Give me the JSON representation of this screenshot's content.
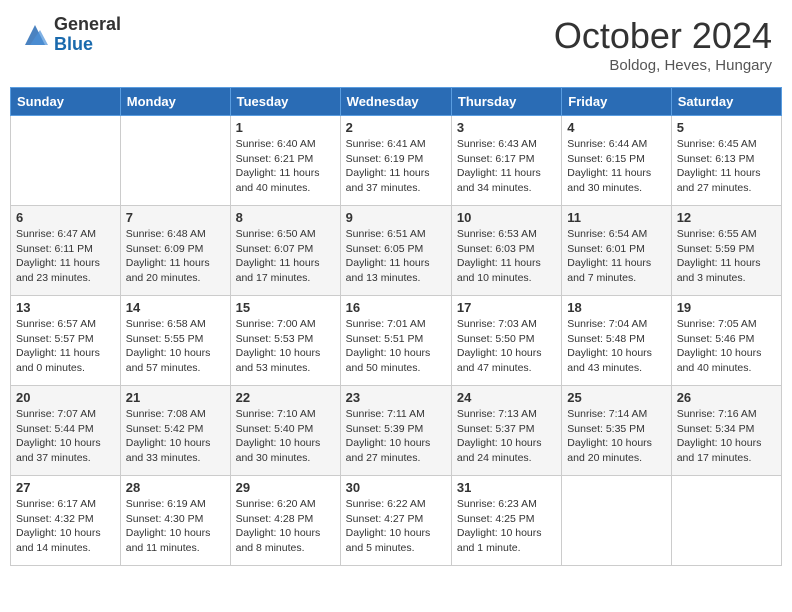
{
  "header": {
    "logo_general": "General",
    "logo_blue": "Blue",
    "month_title": "October 2024",
    "location": "Boldog, Heves, Hungary"
  },
  "days_of_week": [
    "Sunday",
    "Monday",
    "Tuesday",
    "Wednesday",
    "Thursday",
    "Friday",
    "Saturday"
  ],
  "weeks": [
    [
      {
        "day": "",
        "info": ""
      },
      {
        "day": "",
        "info": ""
      },
      {
        "day": "1",
        "info": "Sunrise: 6:40 AM\nSunset: 6:21 PM\nDaylight: 11 hours and 40 minutes."
      },
      {
        "day": "2",
        "info": "Sunrise: 6:41 AM\nSunset: 6:19 PM\nDaylight: 11 hours and 37 minutes."
      },
      {
        "day": "3",
        "info": "Sunrise: 6:43 AM\nSunset: 6:17 PM\nDaylight: 11 hours and 34 minutes."
      },
      {
        "day": "4",
        "info": "Sunrise: 6:44 AM\nSunset: 6:15 PM\nDaylight: 11 hours and 30 minutes."
      },
      {
        "day": "5",
        "info": "Sunrise: 6:45 AM\nSunset: 6:13 PM\nDaylight: 11 hours and 27 minutes."
      }
    ],
    [
      {
        "day": "6",
        "info": "Sunrise: 6:47 AM\nSunset: 6:11 PM\nDaylight: 11 hours and 23 minutes."
      },
      {
        "day": "7",
        "info": "Sunrise: 6:48 AM\nSunset: 6:09 PM\nDaylight: 11 hours and 20 minutes."
      },
      {
        "day": "8",
        "info": "Sunrise: 6:50 AM\nSunset: 6:07 PM\nDaylight: 11 hours and 17 minutes."
      },
      {
        "day": "9",
        "info": "Sunrise: 6:51 AM\nSunset: 6:05 PM\nDaylight: 11 hours and 13 minutes."
      },
      {
        "day": "10",
        "info": "Sunrise: 6:53 AM\nSunset: 6:03 PM\nDaylight: 11 hours and 10 minutes."
      },
      {
        "day": "11",
        "info": "Sunrise: 6:54 AM\nSunset: 6:01 PM\nDaylight: 11 hours and 7 minutes."
      },
      {
        "day": "12",
        "info": "Sunrise: 6:55 AM\nSunset: 5:59 PM\nDaylight: 11 hours and 3 minutes."
      }
    ],
    [
      {
        "day": "13",
        "info": "Sunrise: 6:57 AM\nSunset: 5:57 PM\nDaylight: 11 hours and 0 minutes."
      },
      {
        "day": "14",
        "info": "Sunrise: 6:58 AM\nSunset: 5:55 PM\nDaylight: 10 hours and 57 minutes."
      },
      {
        "day": "15",
        "info": "Sunrise: 7:00 AM\nSunset: 5:53 PM\nDaylight: 10 hours and 53 minutes."
      },
      {
        "day": "16",
        "info": "Sunrise: 7:01 AM\nSunset: 5:51 PM\nDaylight: 10 hours and 50 minutes."
      },
      {
        "day": "17",
        "info": "Sunrise: 7:03 AM\nSunset: 5:50 PM\nDaylight: 10 hours and 47 minutes."
      },
      {
        "day": "18",
        "info": "Sunrise: 7:04 AM\nSunset: 5:48 PM\nDaylight: 10 hours and 43 minutes."
      },
      {
        "day": "19",
        "info": "Sunrise: 7:05 AM\nSunset: 5:46 PM\nDaylight: 10 hours and 40 minutes."
      }
    ],
    [
      {
        "day": "20",
        "info": "Sunrise: 7:07 AM\nSunset: 5:44 PM\nDaylight: 10 hours and 37 minutes."
      },
      {
        "day": "21",
        "info": "Sunrise: 7:08 AM\nSunset: 5:42 PM\nDaylight: 10 hours and 33 minutes."
      },
      {
        "day": "22",
        "info": "Sunrise: 7:10 AM\nSunset: 5:40 PM\nDaylight: 10 hours and 30 minutes."
      },
      {
        "day": "23",
        "info": "Sunrise: 7:11 AM\nSunset: 5:39 PM\nDaylight: 10 hours and 27 minutes."
      },
      {
        "day": "24",
        "info": "Sunrise: 7:13 AM\nSunset: 5:37 PM\nDaylight: 10 hours and 24 minutes."
      },
      {
        "day": "25",
        "info": "Sunrise: 7:14 AM\nSunset: 5:35 PM\nDaylight: 10 hours and 20 minutes."
      },
      {
        "day": "26",
        "info": "Sunrise: 7:16 AM\nSunset: 5:34 PM\nDaylight: 10 hours and 17 minutes."
      }
    ],
    [
      {
        "day": "27",
        "info": "Sunrise: 6:17 AM\nSunset: 4:32 PM\nDaylight: 10 hours and 14 minutes."
      },
      {
        "day": "28",
        "info": "Sunrise: 6:19 AM\nSunset: 4:30 PM\nDaylight: 10 hours and 11 minutes."
      },
      {
        "day": "29",
        "info": "Sunrise: 6:20 AM\nSunset: 4:28 PM\nDaylight: 10 hours and 8 minutes."
      },
      {
        "day": "30",
        "info": "Sunrise: 6:22 AM\nSunset: 4:27 PM\nDaylight: 10 hours and 5 minutes."
      },
      {
        "day": "31",
        "info": "Sunrise: 6:23 AM\nSunset: 4:25 PM\nDaylight: 10 hours and 1 minute."
      },
      {
        "day": "",
        "info": ""
      },
      {
        "day": "",
        "info": ""
      }
    ]
  ]
}
